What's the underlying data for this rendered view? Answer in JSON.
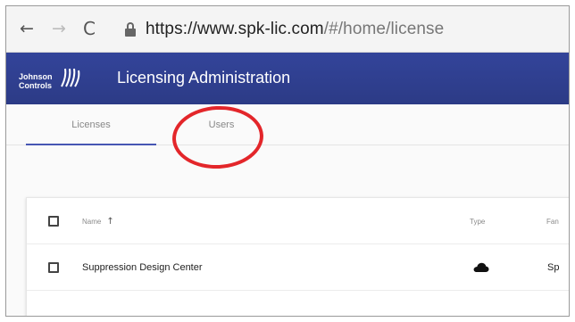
{
  "browser": {
    "back_icon": "←",
    "forward_icon": "→",
    "reload_icon": "C",
    "url_host": "https://www.spk-lic.com",
    "url_path": "/#/home/license"
  },
  "header": {
    "logo_line1": "Johnson",
    "logo_line2": "Controls",
    "title": "Licensing Administration",
    "color": "#2f3f8f"
  },
  "tabs": [
    {
      "label": "Licenses",
      "active": true
    },
    {
      "label": "Users",
      "active": false
    }
  ],
  "annotation": {
    "color": "#e3262a",
    "target": "Users"
  },
  "table": {
    "headers": {
      "name": "Name",
      "type": "Type",
      "family": "Fan"
    },
    "sort_icon": "↑",
    "rows": [
      {
        "name": "Suppression Design Center",
        "type_icon": "cloud-icon",
        "family": "Sp"
      }
    ]
  }
}
